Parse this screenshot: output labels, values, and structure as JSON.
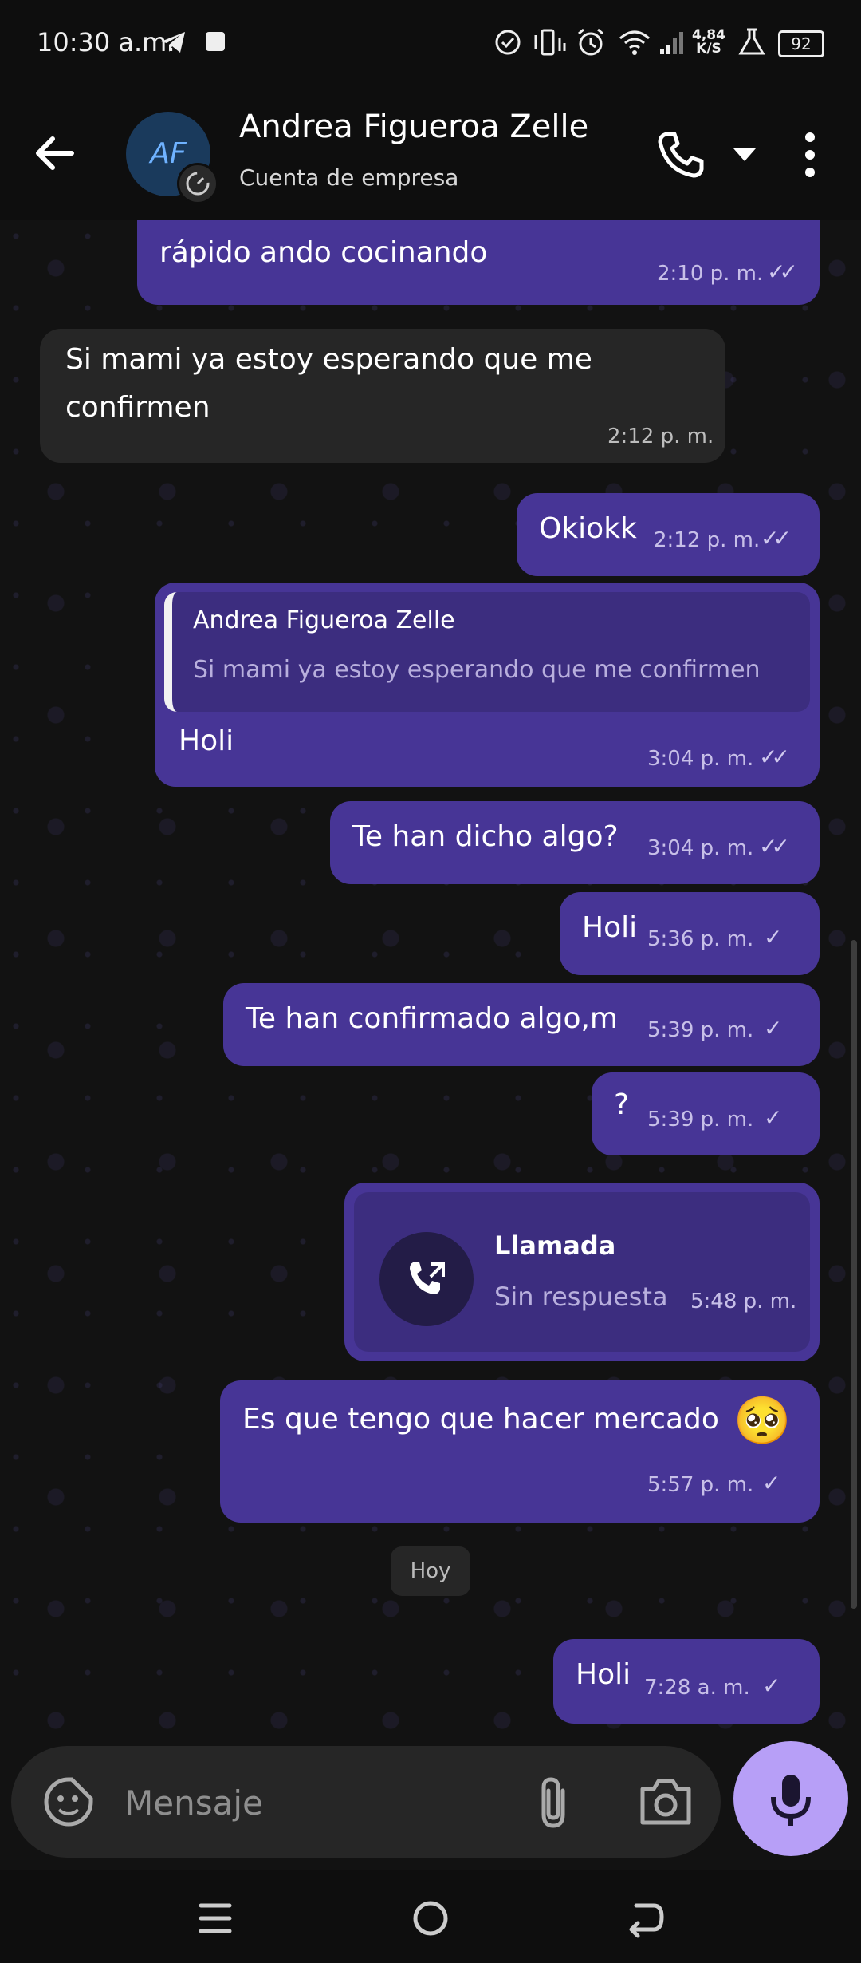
{
  "status_bar": {
    "time": "10:30 a.m.",
    "net_speed_value": "4,84",
    "net_speed_unit": "K/S",
    "battery": "92"
  },
  "header": {
    "avatar_initials": "AF",
    "contact_name": "Andrea Figueroa Zelle",
    "contact_subtitle": "Cuenta de empresa"
  },
  "messages": [
    {
      "id": "m1",
      "text": "rápido ando cocinando",
      "time": "2:10 p. m.",
      "ticks": "✓✓"
    },
    {
      "id": "m2",
      "text_line1": "Si mami ya estoy esperando que me",
      "text_line2": "confirmen",
      "time": "2:12 p. m."
    },
    {
      "id": "m3",
      "text": "Okiokk",
      "time": "2:12 p. m.",
      "ticks": "✓✓"
    },
    {
      "id": "m4",
      "quote_name": "Andrea Figueroa Zelle",
      "quote_text": "Si mami ya estoy esperando que me confirmen",
      "text": "Holi",
      "time": "3:04 p. m.",
      "ticks": "✓✓"
    },
    {
      "id": "m5",
      "text": "Te han dicho algo?",
      "time": "3:04 p. m.",
      "ticks": "✓✓"
    },
    {
      "id": "m6",
      "text": "Holi",
      "time": "5:36 p. m.",
      "ticks": "✓"
    },
    {
      "id": "m7",
      "text": "Te han confirmado algo,m",
      "time": "5:39 p. m.",
      "ticks": "✓"
    },
    {
      "id": "m8",
      "text": "?",
      "time": "5:39 p. m.",
      "ticks": "✓"
    },
    {
      "id": "m9",
      "call_title": "Llamada",
      "call_status": "Sin respuesta",
      "time": "5:48 p. m."
    },
    {
      "id": "m10",
      "text": "Es que tengo que hacer mercado",
      "emoji": "🥺",
      "time": "5:57 p. m.",
      "ticks": "✓"
    },
    {
      "id": "m11",
      "text": "Holi",
      "time": "7:28 a. m.",
      "ticks": "✓"
    }
  ],
  "day_separator": "Hoy",
  "composer": {
    "placeholder": "Mensaje"
  },
  "colors": {
    "outgoing_bubble": "#473596",
    "incoming_bubble": "#262626",
    "mic_button": "#b79ff7",
    "background": "#121212"
  },
  "icons": [
    "telegram-icon",
    "dnd-icon",
    "vibrate-icon",
    "alarm-icon",
    "wifi-icon",
    "signal-icon",
    "flask-icon",
    "back-arrow-icon",
    "phone-icon",
    "dropdown-icon",
    "more-vert-icon",
    "sticker-icon",
    "paperclip-icon",
    "camera-icon",
    "mic-icon",
    "missed-call-icon",
    "menu-icon",
    "home-icon",
    "back-icon"
  ]
}
